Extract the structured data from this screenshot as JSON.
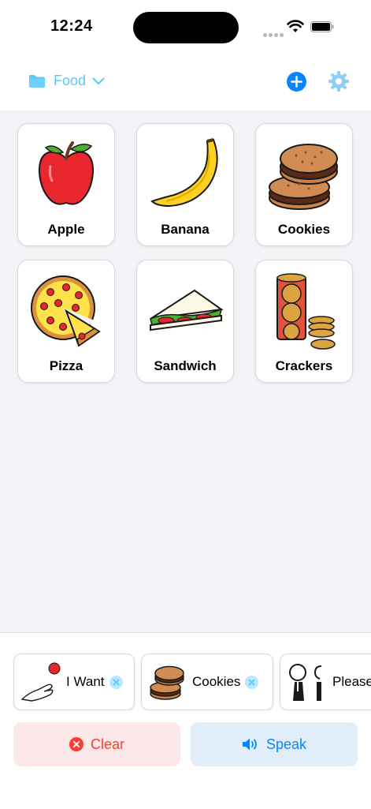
{
  "status_bar": {
    "time": "12:24"
  },
  "navbar": {
    "folder_label": "Food"
  },
  "tiles": [
    {
      "label": "Apple",
      "icon": "apple-icon"
    },
    {
      "label": "Banana",
      "icon": "banana-icon"
    },
    {
      "label": "Cookies",
      "icon": "cookies-icon"
    },
    {
      "label": "Pizza",
      "icon": "pizza-icon"
    },
    {
      "label": "Sandwich",
      "icon": "sandwich-icon"
    },
    {
      "label": "Crackers",
      "icon": "crackers-icon"
    }
  ],
  "sentence": [
    {
      "label": "I Want",
      "icon": "i-want-icon"
    },
    {
      "label": "Cookies",
      "icon": "cookies-icon"
    },
    {
      "label": "Please",
      "icon": "please-icon"
    }
  ],
  "actions": {
    "clear_label": "Clear",
    "speak_label": "Speak"
  },
  "colors": {
    "accent": "#0a84ff",
    "light_accent": "#5ac8fa",
    "destructive": "#ff3b30"
  }
}
